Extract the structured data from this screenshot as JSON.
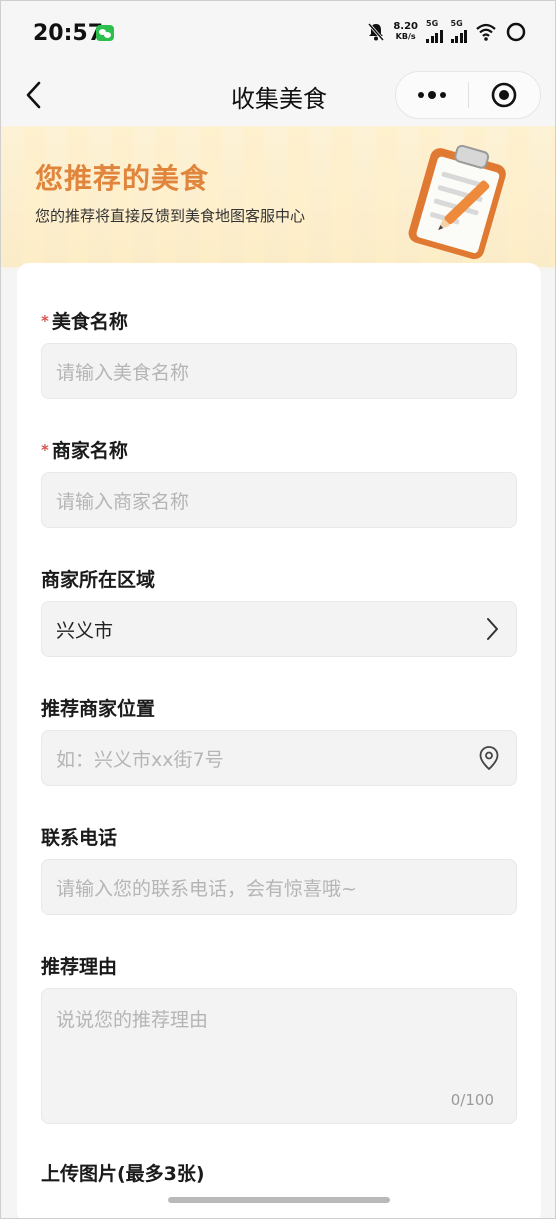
{
  "status_bar": {
    "time": "20:57",
    "speed_value": "8.20",
    "speed_unit": "KB/s",
    "net1": "5G",
    "net2": "5G"
  },
  "nav": {
    "title": "收集美食"
  },
  "banner": {
    "title": "您推荐的美食",
    "subtitle": "您的推荐将直接反馈到美食地图客服中心"
  },
  "form": {
    "food_name": {
      "label": "美食名称",
      "required_mark": "*",
      "placeholder": "请输入美食名称"
    },
    "merchant_name": {
      "label": "商家名称",
      "required_mark": "*",
      "placeholder": "请输入商家名称"
    },
    "region": {
      "label": "商家所在区域",
      "value": "兴义市"
    },
    "location": {
      "label": "推荐商家位置",
      "placeholder": "如：兴义市xx街7号"
    },
    "phone": {
      "label": "联系电话",
      "placeholder": "请输入您的联系电话，会有惊喜哦~"
    },
    "reason": {
      "label": "推荐理由",
      "placeholder": "说说您的推荐理由",
      "counter": "0/100"
    },
    "upload": {
      "label": "上传图片(最多3张)"
    }
  },
  "colors": {
    "accent": "#e0853b",
    "required": "#d9534f",
    "wechat": "#2dbf4e"
  }
}
